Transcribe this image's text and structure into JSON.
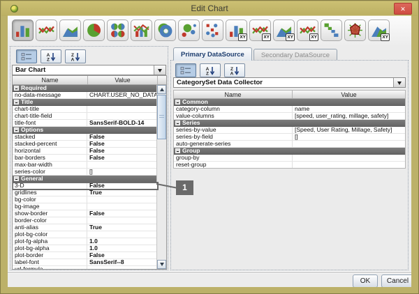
{
  "window": {
    "title": "Edit Chart",
    "close_label": "✕"
  },
  "toolbar": {
    "xy_badge_label": "XY",
    "icons": [
      {
        "name": "bar-chart-icon",
        "selected": true
      },
      {
        "name": "line-chart-icon"
      },
      {
        "name": "area-chart-icon"
      },
      {
        "name": "pie-chart-icon"
      },
      {
        "name": "multi-pie-chart-icon"
      },
      {
        "name": "bar-line-chart-icon"
      },
      {
        "name": "ring-chart-icon"
      },
      {
        "name": "bubble-chart-icon"
      },
      {
        "name": "scatter-chart-icon"
      },
      {
        "name": "bar-xy-chart-icon",
        "xy": true
      },
      {
        "name": "line-xy-chart-icon",
        "xy": true
      },
      {
        "name": "area-xy-chart-icon",
        "xy": true
      },
      {
        "name": "line-xy2-chart-icon",
        "xy": true
      },
      {
        "name": "step-chart-icon"
      },
      {
        "name": "radar-chart-icon"
      },
      {
        "name": "area-xy2-chart-icon",
        "xy": true
      }
    ]
  },
  "left_panel": {
    "toolbar": [
      {
        "name": "categorize-icon",
        "selected": true
      },
      {
        "name": "sort-az-icon"
      },
      {
        "name": "sort-za-icon"
      }
    ],
    "chart_type": "Bar Chart",
    "columns": [
      "Name",
      "Value"
    ],
    "rows": [
      {
        "t": "group",
        "n": "Required"
      },
      {
        "t": "prop",
        "n": "no-data-message",
        "v": "CHART.USER_NO_DATA_..."
      },
      {
        "t": "group",
        "n": "Title"
      },
      {
        "t": "prop",
        "n": "chart-title",
        "v": ""
      },
      {
        "t": "prop",
        "n": "chart-title-field",
        "v": ""
      },
      {
        "t": "prop",
        "n": "title-font",
        "v": "SansSerif-BOLD-14",
        "b": true
      },
      {
        "t": "group",
        "n": "Options"
      },
      {
        "t": "prop",
        "n": "stacked",
        "v": "False",
        "b": true
      },
      {
        "t": "prop",
        "n": "stacked-percent",
        "v": "False",
        "b": true
      },
      {
        "t": "prop",
        "n": "horizontal",
        "v": "False",
        "b": true
      },
      {
        "t": "prop",
        "n": "bar-borders",
        "v": "False",
        "b": true
      },
      {
        "t": "prop",
        "n": "max-bar-width",
        "v": ""
      },
      {
        "t": "prop",
        "n": "series-color",
        "v": "[]"
      },
      {
        "t": "group",
        "n": "General"
      },
      {
        "t": "prop",
        "n": "3-D",
        "v": "False",
        "b": true,
        "hl": true
      },
      {
        "t": "prop",
        "n": "gridlines",
        "v": "True",
        "b": true
      },
      {
        "t": "prop",
        "n": "bg-color",
        "v": ""
      },
      {
        "t": "prop",
        "n": "bg-image",
        "v": ""
      },
      {
        "t": "prop",
        "n": "show-border",
        "v": "False",
        "b": true
      },
      {
        "t": "prop",
        "n": "border-color",
        "v": ""
      },
      {
        "t": "prop",
        "n": "anti-alias",
        "v": "True",
        "b": true
      },
      {
        "t": "prop",
        "n": "plot-bg-color",
        "v": ""
      },
      {
        "t": "prop",
        "n": "plot-fg-alpha",
        "v": "1.0",
        "b": true
      },
      {
        "t": "prop",
        "n": "plot-bg-alpha",
        "v": "1.0",
        "b": true
      },
      {
        "t": "prop",
        "n": "plot-border",
        "v": "False",
        "b": true
      },
      {
        "t": "prop",
        "n": "label-font",
        "v": "SansSerif--8",
        "b": true
      },
      {
        "t": "prop",
        "n": "url-formula",
        "v": ""
      }
    ]
  },
  "right_panel": {
    "tabs": [
      {
        "label": "Primary DataSource",
        "active": true
      },
      {
        "label": "Secondary DataSource",
        "active": false
      }
    ],
    "toolbar": [
      {
        "name": "categorize-icon",
        "selected": true
      },
      {
        "name": "sort-az-icon"
      },
      {
        "name": "sort-za-icon"
      }
    ],
    "collector": "CategorySet Data Collector",
    "columns": [
      "Name",
      "Value"
    ],
    "rows": [
      {
        "t": "group",
        "n": "Common"
      },
      {
        "t": "prop",
        "n": "category-column",
        "v": "name"
      },
      {
        "t": "prop",
        "n": "value-columns",
        "v": "[speed, user_rating, millage, safety]"
      },
      {
        "t": "group",
        "n": "Series"
      },
      {
        "t": "prop",
        "n": "series-by-value",
        "v": "[Speed, User Rating, Millage, Safety]"
      },
      {
        "t": "prop",
        "n": "series-by-field",
        "v": "[]"
      },
      {
        "t": "prop",
        "n": "auto-generate-series",
        "v": ""
      },
      {
        "t": "group",
        "n": "Group"
      },
      {
        "t": "prop",
        "n": "group-by",
        "v": ""
      },
      {
        "t": "prop",
        "n": "reset-group",
        "v": ""
      }
    ]
  },
  "annotation": {
    "label": "1"
  },
  "footer": {
    "ok": "OK",
    "cancel": "Cancel"
  },
  "colors": {
    "titlebar": "#c3b76c",
    "close_button": "#d4574b",
    "group_header": "#6f6f6f",
    "annotation": "#6a6a6a",
    "accent_blue": "#4a7ebb",
    "accent_green": "#58a030",
    "accent_red": "#c0392b"
  }
}
